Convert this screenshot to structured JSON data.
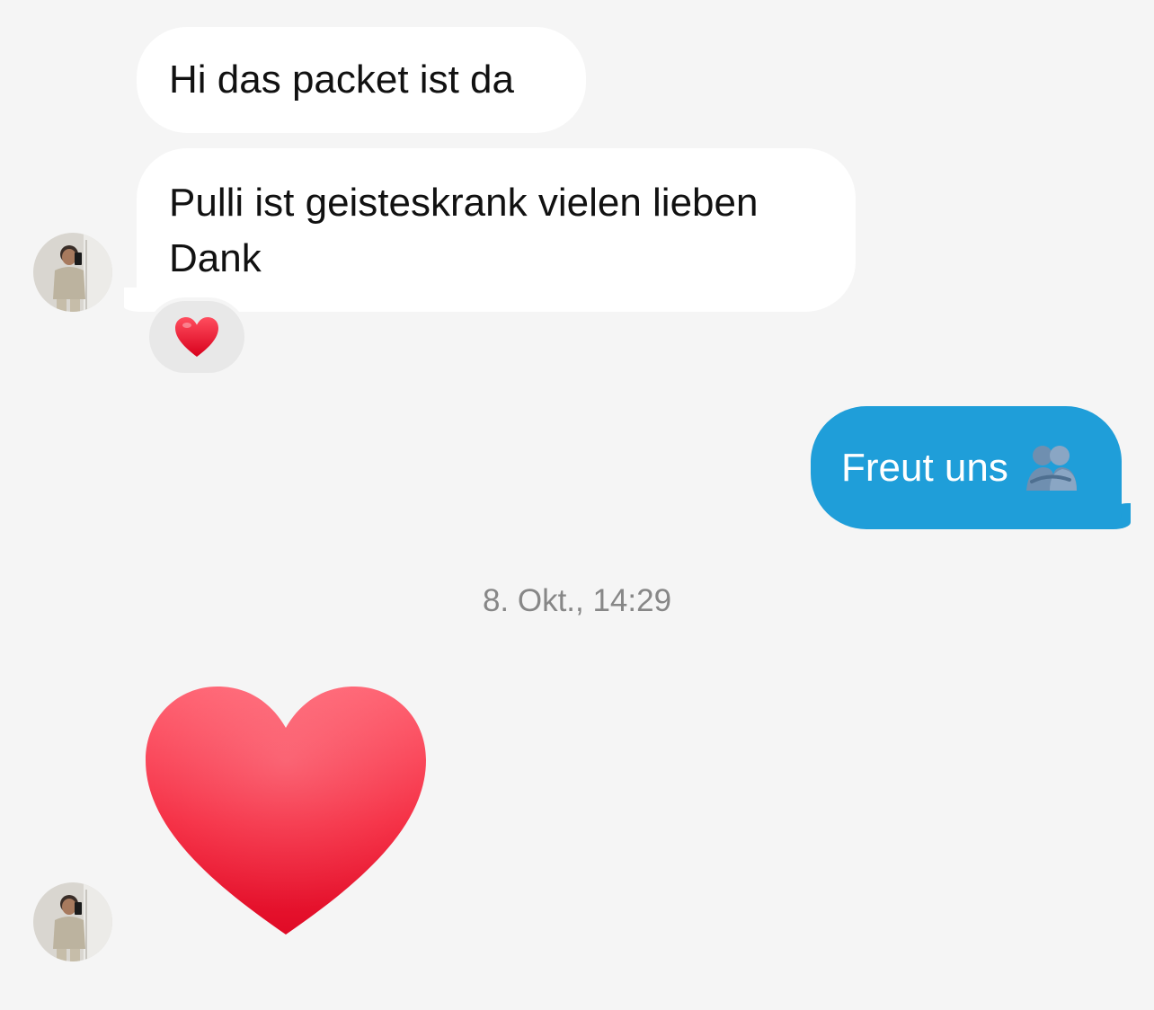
{
  "messages": [
    {
      "direction": "incoming",
      "text": "Hi das packet ist da"
    },
    {
      "direction": "incoming",
      "text": "Pulli ist geisteskrank vielen lieben Dank",
      "reaction_icon": "red-heart-emoji"
    },
    {
      "direction": "outgoing",
      "text": "Freut uns",
      "trailing_icon": "people-hugging-emoji"
    }
  ],
  "timestamp": "8. Okt., 14:29",
  "large_emoji": "red-heart-emoji",
  "colors": {
    "background": "#f5f5f5",
    "incoming_bubble": "#ffffff",
    "outgoing_bubble": "#1f9ed9",
    "timestamp_text": "#878787"
  }
}
